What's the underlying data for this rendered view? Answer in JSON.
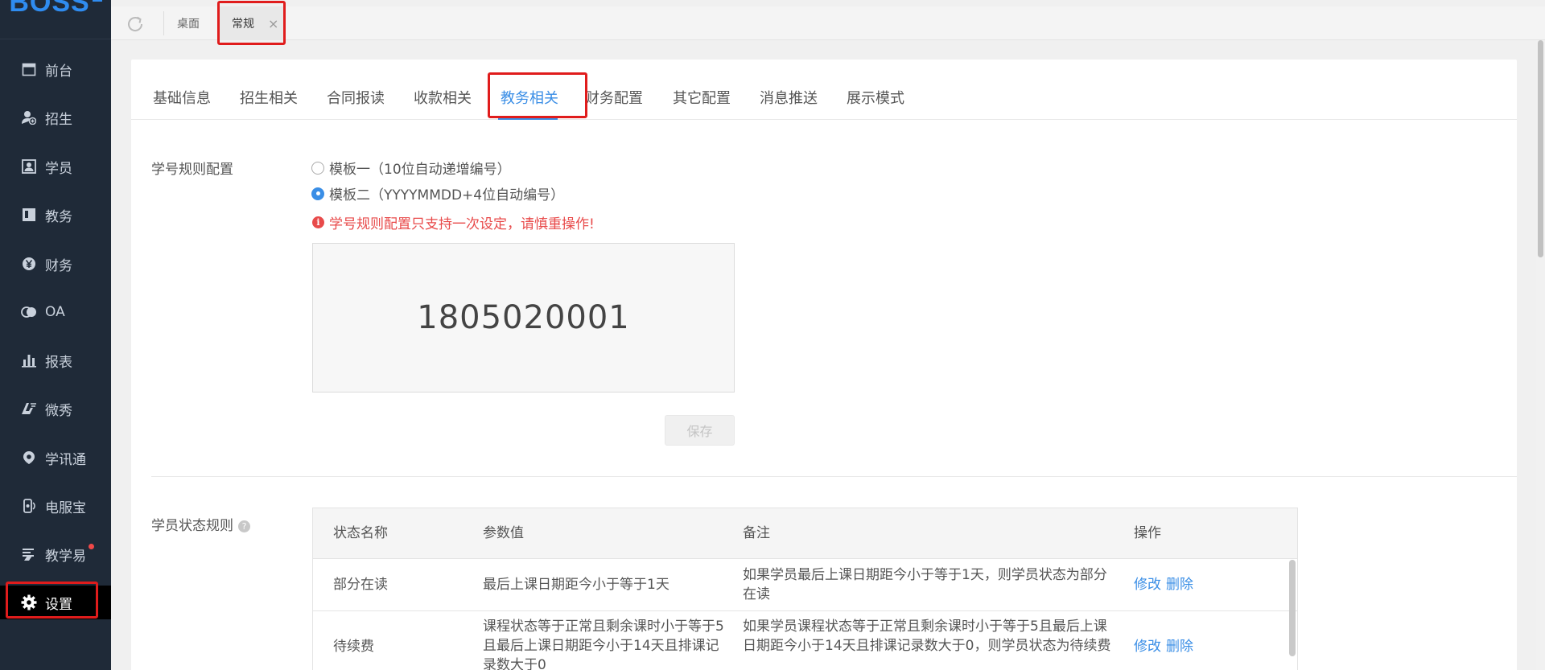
{
  "app": {
    "logo": "BOSS"
  },
  "sidebar": {
    "items": [
      {
        "label": "前台",
        "icon": "calendar-icon"
      },
      {
        "label": "招生",
        "icon": "user-add-icon"
      },
      {
        "label": "学员",
        "icon": "id-card-icon"
      },
      {
        "label": "教务",
        "icon": "book-icon"
      },
      {
        "label": "财务",
        "icon": "yen-icon"
      },
      {
        "label": "OA",
        "icon": "chat-icon"
      },
      {
        "label": "报表",
        "icon": "bar-chart-icon"
      },
      {
        "label": "微秀",
        "icon": "weixiu-icon"
      },
      {
        "label": "学讯通",
        "icon": "location-icon"
      },
      {
        "label": "电服宝",
        "icon": "phone-icon"
      },
      {
        "label": "教学易",
        "icon": "teach-icon",
        "badge": true
      },
      {
        "label": "设置",
        "icon": "gear-icon",
        "active": true
      }
    ]
  },
  "topbar": {
    "tabs": [
      {
        "label": "桌面"
      },
      {
        "label": "常规",
        "close": "×",
        "active": true
      }
    ]
  },
  "subtabs": [
    "基础信息",
    "招生相关",
    "合同报读",
    "收款相关",
    "教务相关",
    "财务配置",
    "其它配置",
    "消息推送",
    "展示模式"
  ],
  "student_no": {
    "label": "学号规则配置",
    "option1": "模板一（10位自动递增编号）",
    "option2": "模板二（YYYYMMDD+4位自动编号）",
    "selected": 2,
    "warning": "学号规则配置只支持一次设定，请慎重操作!",
    "preview": "1805020001",
    "save": "保存"
  },
  "status_rules": {
    "label": "学员状态规则",
    "headers": [
      "状态名称",
      "参数值",
      "备注",
      "操作"
    ],
    "rows": [
      {
        "name": "部分在读",
        "param": "最后上课日期距今小于等于1天",
        "note": "如果学员最后上课日期距今小于等于1天，则学员状态为部分在读",
        "edit": "修改",
        "delete": "删除"
      },
      {
        "name": "待续费",
        "param": "课程状态等于正常且剩余课时小于等于5且最后上课日期距今小于14天且排课记录数大于0",
        "note": "如果学员课程状态等于正常且剩余课时小于等于5且最后上课日期距今小于14天且排课记录数大于0，则学员状态为待续费",
        "edit": "修改",
        "delete": "删除"
      }
    ]
  },
  "colors": {
    "accent": "#3a8ee6",
    "sidebar_bg": "#1f2a38",
    "warning": "#e84a4a",
    "highlight_box": "#e01c1c"
  }
}
